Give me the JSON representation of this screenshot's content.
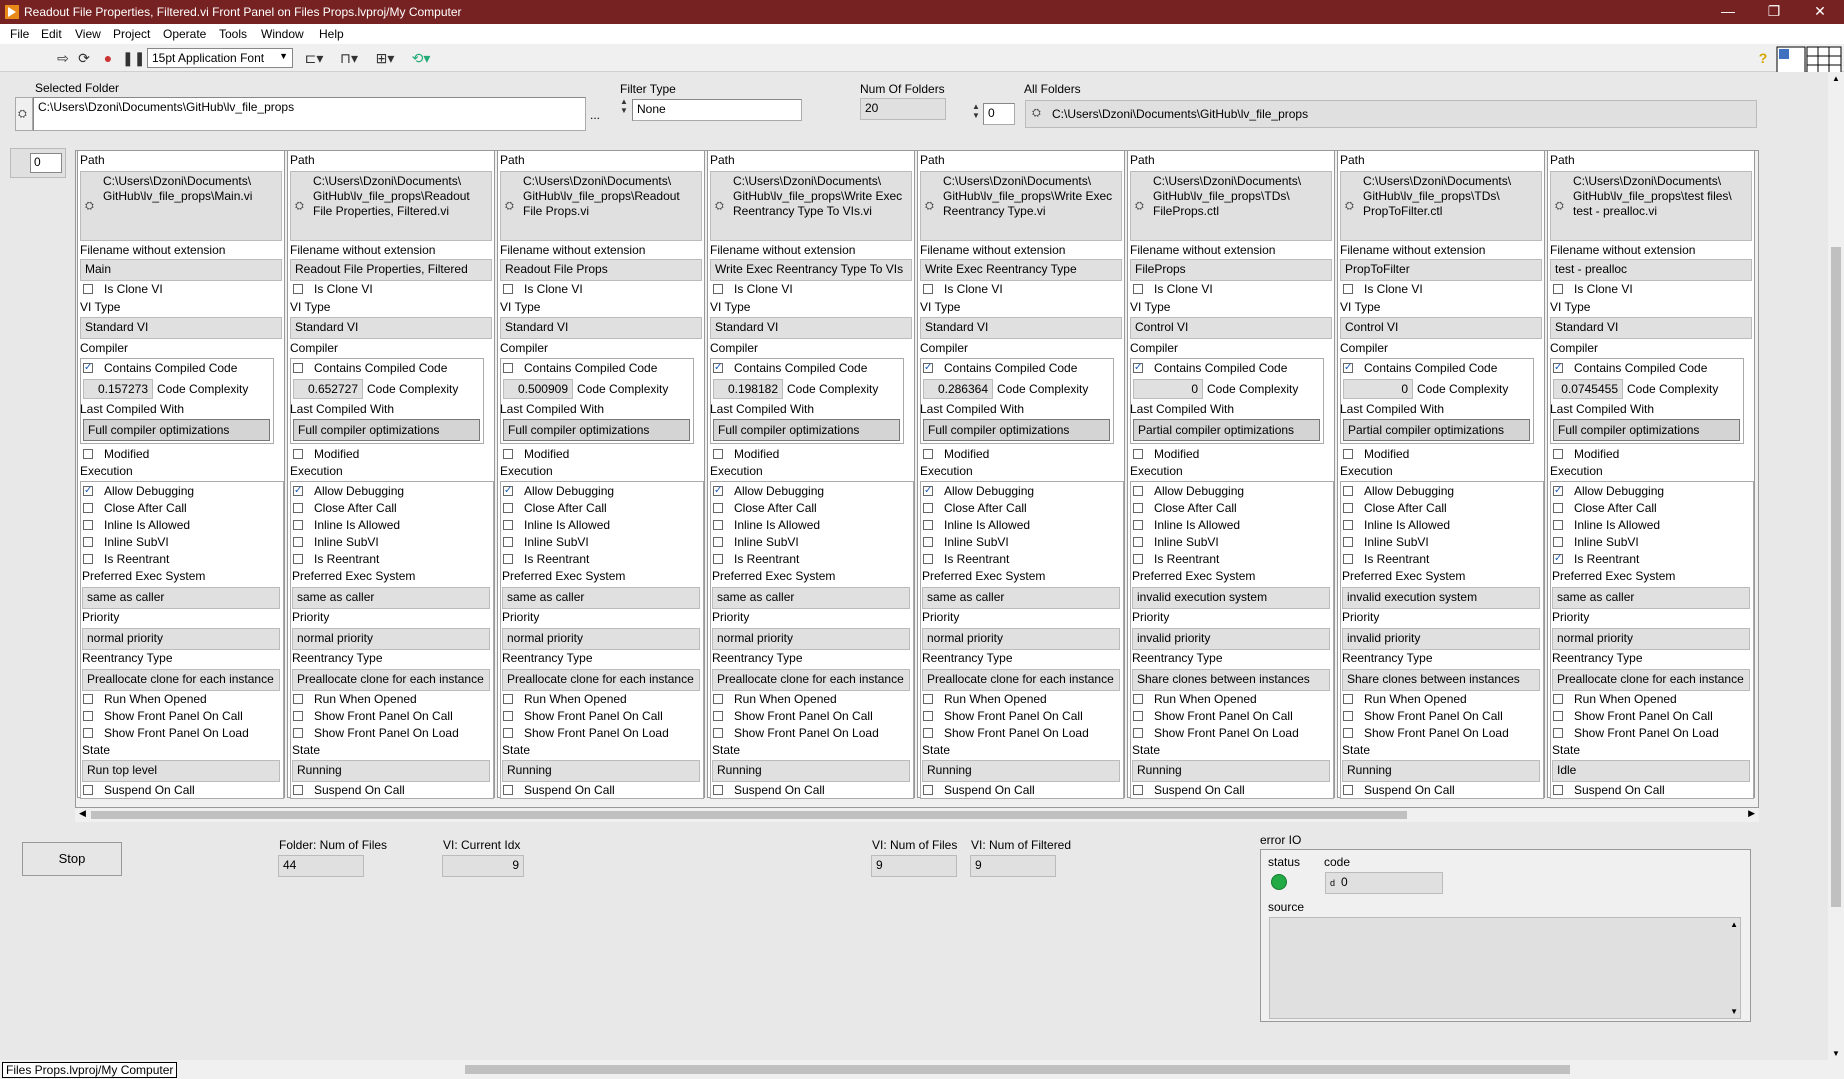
{
  "window": {
    "title": "Readout File Properties, Filtered.vi Front Panel on Files Props.lvproj/My Computer",
    "minimize": "—",
    "restore": "❐",
    "close": "✕"
  },
  "menu": [
    "File",
    "Edit",
    "View",
    "Project",
    "Operate",
    "Tools",
    "Window",
    "Help"
  ],
  "toolbar": {
    "font": "15pt Application Font",
    "icons": [
      "run-arrow-icon",
      "run-continuously-icon",
      "abort-icon",
      "pause-icon",
      "align-icon",
      "distribute-icon",
      "resize-icon",
      "reorder-icon",
      "help-icon"
    ]
  },
  "top": {
    "selected_folder_label": "Selected Folder",
    "selected_folder_value": "C:\\Users\\Dzoni\\Documents\\GitHub\\lv_file_props",
    "browse": "...",
    "filter_type_label": "Filter Type",
    "filter_type_value": "None",
    "num_folders_label": "Num Of Folders",
    "num_folders_value": "20",
    "all_folders_label": "All Folders",
    "all_folders_index": "0",
    "all_folders_value": "C:\\Users\\Dzoni\\Documents\\GitHub\\lv_file_props",
    "array_index": "0"
  },
  "labels": {
    "path": "Path",
    "filename": "Filename without extension",
    "is_clone": "Is Clone VI",
    "vi_type": "VI Type",
    "compiler": "Compiler",
    "contains_compiled": "Contains Compiled Code",
    "code_complexity": "Code Complexity",
    "last_compiled": "Last Compiled With",
    "modified": "Modified",
    "execution": "Execution",
    "allow_debugging": "Allow Debugging",
    "close_after_call": "Close After Call",
    "inline_allowed": "Inline Is Allowed",
    "inline_subvi": "Inline SubVI",
    "is_reentrant": "Is Reentrant",
    "preferred_exec": "Preferred Exec System",
    "priority": "Priority",
    "reentrancy_type": "Reentrancy Type",
    "run_when_opened": "Run When Opened",
    "show_fp_on_call": "Show Front Panel On Call",
    "show_fp_on_load": "Show Front Panel On Load",
    "state": "State",
    "suspend_on_call": "Suspend On Call"
  },
  "columns": [
    {
      "path": [
        "C:\\Users\\Dzoni\\Documents\\",
        "GitHub\\lv_file_props\\Main.vi",
        ""
      ],
      "filename": "Main",
      "is_clone": false,
      "vi_type": "Standard VI",
      "contains_compiled": true,
      "code_complexity": "0.157273",
      "last_compiled": "Full compiler optimizations",
      "modified": false,
      "allow_debugging": true,
      "close_after_call": false,
      "inline_allowed": false,
      "inline_subvi": false,
      "is_reentrant": false,
      "preferred_exec": "same as caller",
      "priority": "normal priority",
      "reentrancy_type": "Preallocate clone for each instance",
      "run_when_opened": false,
      "show_fp_on_call": false,
      "show_fp_on_load": false,
      "state": "Run top level",
      "suspend_on_call": false
    },
    {
      "path": [
        "C:\\Users\\Dzoni\\Documents\\",
        "GitHub\\lv_file_props\\Readout",
        "File Properties, Filtered.vi"
      ],
      "filename": "Readout File Properties, Filtered",
      "is_clone": false,
      "vi_type": "Standard VI",
      "contains_compiled": false,
      "code_complexity": "0.652727",
      "last_compiled": "Full compiler optimizations",
      "modified": false,
      "allow_debugging": true,
      "close_after_call": false,
      "inline_allowed": false,
      "inline_subvi": false,
      "is_reentrant": false,
      "preferred_exec": "same as caller",
      "priority": "normal priority",
      "reentrancy_type": "Preallocate clone for each instance",
      "run_when_opened": false,
      "show_fp_on_call": false,
      "show_fp_on_load": false,
      "state": "Running",
      "suspend_on_call": false
    },
    {
      "path": [
        "C:\\Users\\Dzoni\\Documents\\",
        "GitHub\\lv_file_props\\Readout",
        "File Props.vi"
      ],
      "filename": "Readout File Props",
      "is_clone": false,
      "vi_type": "Standard VI",
      "contains_compiled": false,
      "code_complexity": "0.500909",
      "last_compiled": "Full compiler optimizations",
      "modified": false,
      "allow_debugging": true,
      "close_after_call": false,
      "inline_allowed": false,
      "inline_subvi": false,
      "is_reentrant": false,
      "preferred_exec": "same as caller",
      "priority": "normal priority",
      "reentrancy_type": "Preallocate clone for each instance",
      "run_when_opened": false,
      "show_fp_on_call": false,
      "show_fp_on_load": false,
      "state": "Running",
      "suspend_on_call": false
    },
    {
      "path": [
        "C:\\Users\\Dzoni\\Documents\\",
        "GitHub\\lv_file_props\\Write Exec",
        "Reentrancy Type To VIs.vi"
      ],
      "filename": "Write Exec Reentrancy Type To VIs",
      "is_clone": false,
      "vi_type": "Standard VI",
      "contains_compiled": true,
      "code_complexity": "0.198182",
      "last_compiled": "Full compiler optimizations",
      "modified": false,
      "allow_debugging": true,
      "close_after_call": false,
      "inline_allowed": false,
      "inline_subvi": false,
      "is_reentrant": false,
      "preferred_exec": "same as caller",
      "priority": "normal priority",
      "reentrancy_type": "Preallocate clone for each instance",
      "run_when_opened": false,
      "show_fp_on_call": false,
      "show_fp_on_load": false,
      "state": "Running",
      "suspend_on_call": false
    },
    {
      "path": [
        "C:\\Users\\Dzoni\\Documents\\",
        "GitHub\\lv_file_props\\Write Exec",
        "Reentrancy Type.vi"
      ],
      "filename": "Write Exec Reentrancy Type",
      "is_clone": false,
      "vi_type": "Standard VI",
      "contains_compiled": true,
      "code_complexity": "0.286364",
      "last_compiled": "Full compiler optimizations",
      "modified": false,
      "allow_debugging": true,
      "close_after_call": false,
      "inline_allowed": false,
      "inline_subvi": false,
      "is_reentrant": false,
      "preferred_exec": "same as caller",
      "priority": "normal priority",
      "reentrancy_type": "Preallocate clone for each instance",
      "run_when_opened": false,
      "show_fp_on_call": false,
      "show_fp_on_load": false,
      "state": "Running",
      "suspend_on_call": false
    },
    {
      "path": [
        "C:\\Users\\Dzoni\\Documents\\",
        "GitHub\\lv_file_props\\TDs\\",
        "FileProps.ctl"
      ],
      "filename": "FileProps",
      "is_clone": false,
      "vi_type": "Control VI",
      "contains_compiled": true,
      "code_complexity": "0",
      "last_compiled": "Partial compiler optimizations",
      "modified": false,
      "allow_debugging": false,
      "close_after_call": false,
      "inline_allowed": false,
      "inline_subvi": false,
      "is_reentrant": false,
      "preferred_exec": "invalid execution system",
      "priority": "invalid priority",
      "reentrancy_type": "Share clones between instances",
      "run_when_opened": false,
      "show_fp_on_call": false,
      "show_fp_on_load": false,
      "state": "Running",
      "suspend_on_call": false
    },
    {
      "path": [
        "C:\\Users\\Dzoni\\Documents\\",
        "GitHub\\lv_file_props\\TDs\\",
        "PropToFilter.ctl"
      ],
      "filename": "PropToFilter",
      "is_clone": false,
      "vi_type": "Control VI",
      "contains_compiled": true,
      "code_complexity": "0",
      "last_compiled": "Partial compiler optimizations",
      "modified": false,
      "allow_debugging": false,
      "close_after_call": false,
      "inline_allowed": false,
      "inline_subvi": false,
      "is_reentrant": false,
      "preferred_exec": "invalid execution system",
      "priority": "invalid priority",
      "reentrancy_type": "Share clones between instances",
      "run_when_opened": false,
      "show_fp_on_call": false,
      "show_fp_on_load": false,
      "state": "Running",
      "suspend_on_call": false
    },
    {
      "path": [
        "C:\\Users\\Dzoni\\Documents\\",
        "GitHub\\lv_file_props\\test files\\",
        "test - prealloc.vi"
      ],
      "filename": "test - prealloc",
      "is_clone": false,
      "vi_type": "Standard VI",
      "contains_compiled": true,
      "code_complexity": "0.0745455",
      "last_compiled": "Full compiler optimizations",
      "modified": false,
      "allow_debugging": true,
      "close_after_call": false,
      "inline_allowed": false,
      "inline_subvi": false,
      "is_reentrant": true,
      "preferred_exec": "same as caller",
      "priority": "normal priority",
      "reentrancy_type": "Preallocate clone for each instance",
      "run_when_opened": false,
      "show_fp_on_call": false,
      "show_fp_on_load": false,
      "state": "Idle",
      "suspend_on_call": false
    }
  ],
  "bottom": {
    "stop": "Stop",
    "folder_num_files_label": "Folder: Num of Files",
    "folder_num_files_value": "44",
    "vi_current_idx_label": "VI: Current Idx",
    "vi_current_idx_value": "9",
    "vi_num_files_label": "VI: Num of Files",
    "vi_num_files_value": "9",
    "vi_num_filtered_label": "VI: Num of Filtered",
    "vi_num_filtered_value": "9"
  },
  "error_io": {
    "label": "error IO",
    "status_label": "status",
    "code_label": "code",
    "code_prefix": "d",
    "code_value": "0",
    "source_label": "source",
    "status_color": "#22aa44"
  },
  "statusbar": "Files Props.lvproj/My Computer"
}
